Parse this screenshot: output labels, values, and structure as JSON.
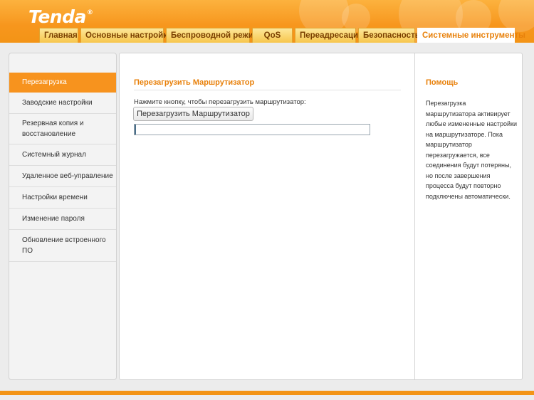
{
  "brand": {
    "logo_text": "Tenda",
    "logo_mark": "®"
  },
  "tabs": [
    {
      "label": "Главная"
    },
    {
      "label": "Основные настройки"
    },
    {
      "label": "Беспроводной режим"
    },
    {
      "label": "QoS"
    },
    {
      "label": "Переадресация"
    },
    {
      "label": "Безопасность"
    },
    {
      "label": "Системные инструменты",
      "active": true
    }
  ],
  "sidebar": {
    "items": [
      {
        "label": "Перезагрузка",
        "active": true
      },
      {
        "label": "Заводские настройки"
      },
      {
        "label": "Резервная копия и восстановление"
      },
      {
        "label": "Системный журнал"
      },
      {
        "label": "Удаленное веб-управление"
      },
      {
        "label": "Настройки времени"
      },
      {
        "label": "Изменение пароля"
      },
      {
        "label": "Обновление встроенного ПО"
      }
    ]
  },
  "main": {
    "title": "Перезагрузить Маршрутизатор",
    "instruction": "Нажмите кнопку, чтобы перезагрузить маршрутизатор:",
    "reboot_button": "Перезагрузить Маршрутизатор",
    "progress": 0
  },
  "help": {
    "title": "Помощь",
    "text": "Перезагрузка маршрутизатора активирует любые измененные настройки на маршрутизаторе. Пока маршрутизатор перезагружается, все соединения будут потеряны, но после завершения процесса будут повторно подключены автоматически."
  },
  "colors": {
    "accent": "#f7931e",
    "header": "#f7961d",
    "heading": "#e8800a"
  }
}
